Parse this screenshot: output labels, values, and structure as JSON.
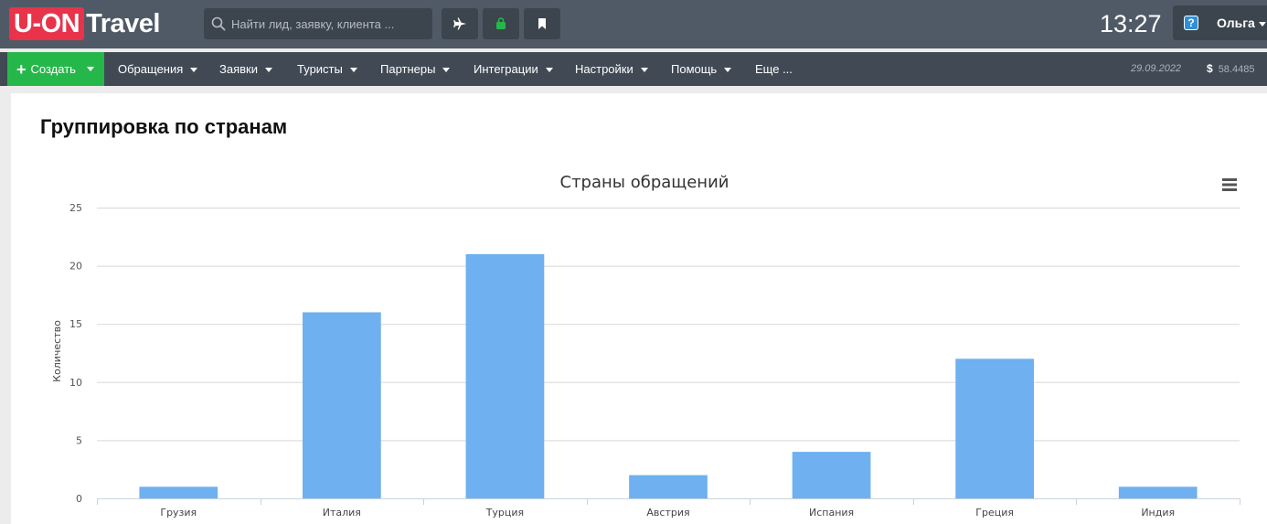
{
  "header": {
    "logo_box": "U-ON",
    "logo_text": "Travel",
    "search_placeholder": "Найти лид, заявку, клиента ...",
    "clock": "13:27",
    "user_name": "Ольга",
    "help_label": "?"
  },
  "nav": {
    "create_label": "Создать",
    "items": [
      "Обращения",
      "Заявки",
      "Туристы",
      "Партнеры",
      "Интеграции",
      "Настройки",
      "Помощь",
      "Еще ..."
    ],
    "date": "29.09.2022",
    "currency_symbol": "$",
    "rate": "58.4485"
  },
  "page": {
    "title": "Группировка по странам"
  },
  "colors": {
    "bar": "#6eb0f0",
    "create_button": "#26b74b",
    "logo": "#e8334a",
    "header": "#505a66",
    "navbar": "#414a54"
  },
  "chart_data": {
    "type": "bar",
    "title": "Страны обращений",
    "ylabel": "Количество",
    "xlabel": "",
    "categories": [
      "Грузия",
      "Италия",
      "Турция",
      "Австрия",
      "Испания",
      "Греция",
      "Индия"
    ],
    "values": [
      1,
      16,
      21,
      2,
      4,
      12,
      1
    ],
    "ylim": [
      0,
      25
    ],
    "yticks": [
      0,
      5,
      10,
      15,
      20,
      25
    ],
    "grid": true,
    "legend": "none",
    "color": "#6eb0f0"
  }
}
